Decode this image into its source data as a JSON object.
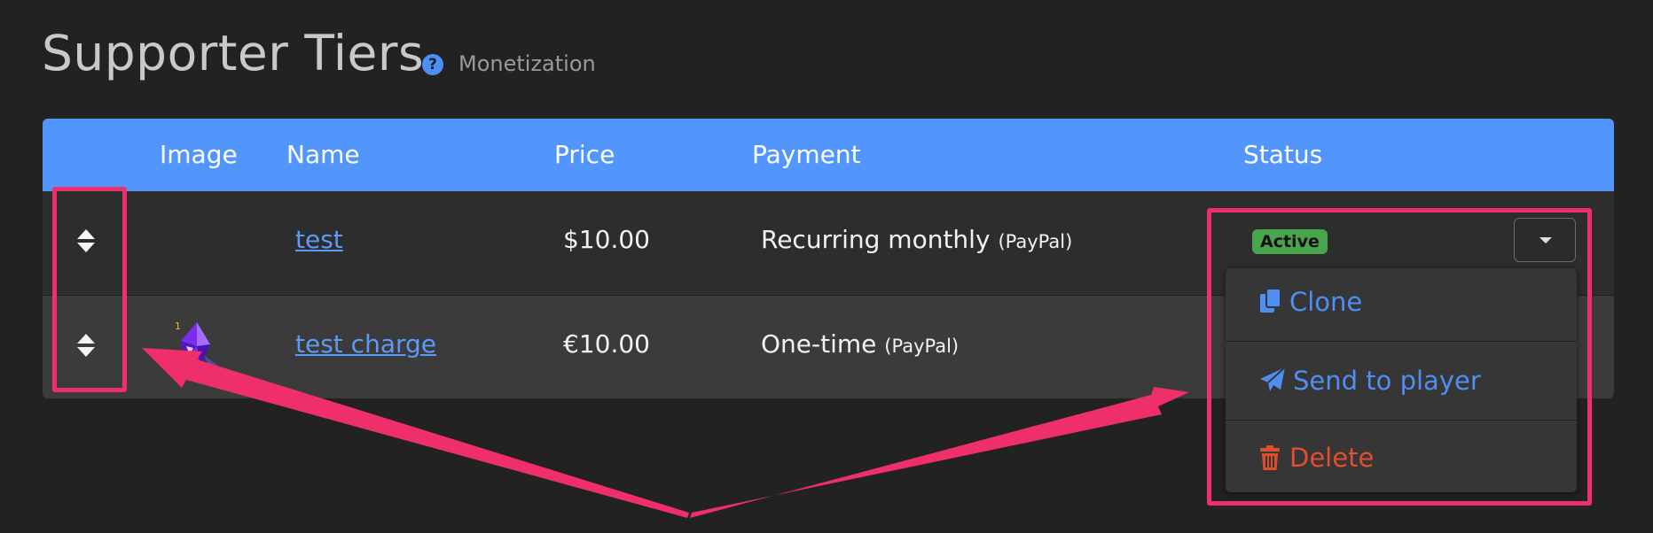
{
  "header": {
    "title": "Supporter Tiers",
    "help_icon": "question-circle-icon",
    "subtitle": "Monetization"
  },
  "table": {
    "columns": [
      "Image",
      "Name",
      "Price",
      "Payment",
      "Status"
    ],
    "rows": [
      {
        "name": "test",
        "price": "$10.00",
        "payment": "Recurring monthly",
        "provider": "(PayPal)",
        "status": "Active",
        "image": ""
      },
      {
        "name": "test charge",
        "price": "€10.00",
        "payment": "One-time",
        "provider": "(PayPal)",
        "status": "",
        "image": "purple-crystal-icon"
      }
    ]
  },
  "dropdown": {
    "items": [
      {
        "label": "Clone",
        "icon": "copy-icon",
        "color": "#4f8ef2"
      },
      {
        "label": "Send to player",
        "icon": "paper-plane-icon",
        "color": "#4f8ef2"
      },
      {
        "label": "Delete",
        "icon": "trash-icon",
        "color": "#e04e2e"
      }
    ]
  },
  "colors": {
    "background": "#222223",
    "table_header": "#5296fb",
    "annotation": "#ef2f6a",
    "active_badge": "#49a54c"
  }
}
